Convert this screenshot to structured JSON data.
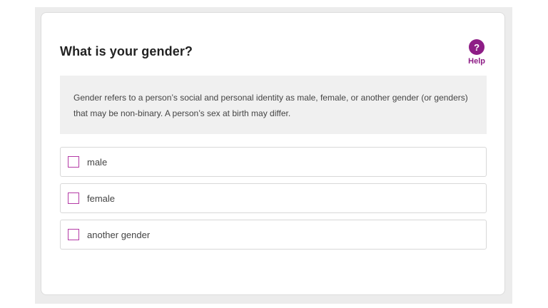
{
  "question": {
    "title": "What is your gender?",
    "description": "Gender refers to a person’s social and personal identity as male, female, or another gender (or genders) that may be non-binary. A person’s sex at birth may differ."
  },
  "help": {
    "icon_glyph": "?",
    "label": "Help",
    "icon": "help-circle-icon"
  },
  "options": [
    {
      "label": "male",
      "checked": false
    },
    {
      "label": "female",
      "checked": false
    },
    {
      "label": "another gender",
      "checked": false
    }
  ],
  "colors": {
    "accent": "#8e1d86",
    "checkbox_border": "#b43aa6",
    "description_bg": "#f0f0f0"
  }
}
